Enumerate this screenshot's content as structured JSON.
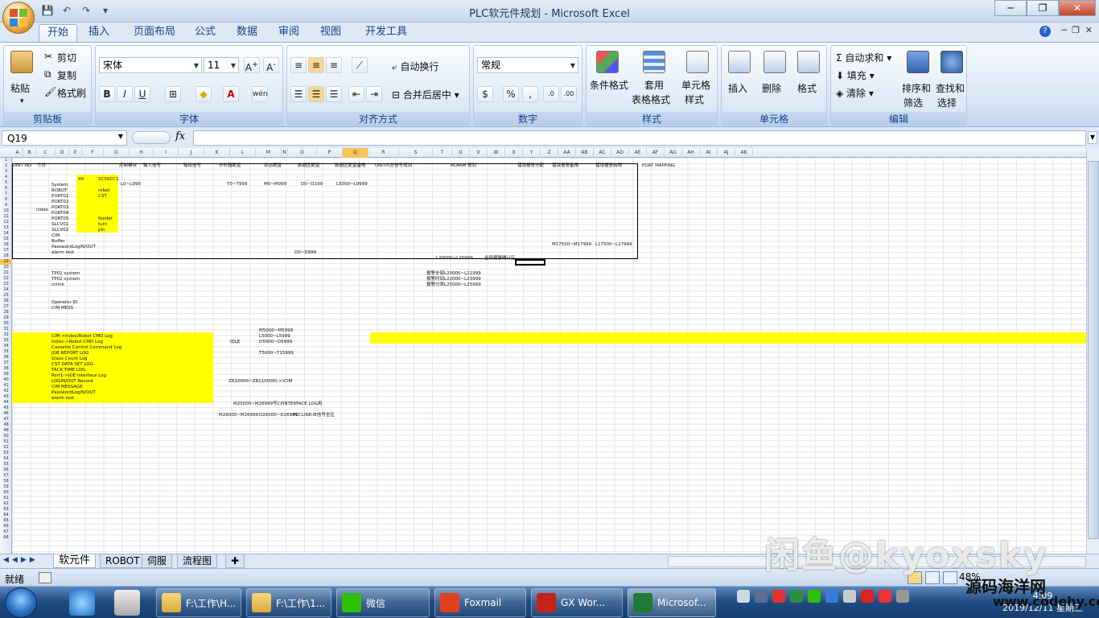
{
  "window": {
    "title": "PLC软元件规划 - Microsoft Excel"
  },
  "tabs": [
    "开始",
    "插入",
    "页面布局",
    "公式",
    "数据",
    "审阅",
    "视图",
    "开发工具"
  ],
  "ribbon": {
    "clipboard": {
      "label": "剪贴板",
      "paste": "粘贴",
      "cut": "剪切",
      "copy": "复制",
      "format_painter": "格式刷"
    },
    "font": {
      "label": "字体",
      "name": "宋体",
      "size": "11"
    },
    "alignment": {
      "label": "对齐方式",
      "wrap": "自动换行",
      "merge": "合并后居中"
    },
    "number": {
      "label": "数字",
      "format": "常规"
    },
    "styles": {
      "label": "样式",
      "cond": "条件格式",
      "table1": "套用",
      "table2": "表格格式",
      "cell1": "单元格",
      "cell2": "样式"
    },
    "cells": {
      "label": "单元格",
      "insert": "插入",
      "delete": "删除",
      "format": "格式"
    },
    "editing": {
      "label": "编辑",
      "autosum": "自动求和",
      "fill": "填充",
      "clear": "清除",
      "sort1": "排序和",
      "sort2": "筛选",
      "find1": "查找和",
      "find2": "选择"
    }
  },
  "formula_bar": {
    "name_box": "Q19",
    "fx": "fx",
    "value": ""
  },
  "sheet": {
    "columns": [
      "A",
      "B",
      "C",
      "D",
      "E",
      "F",
      "G",
      "H",
      "I",
      "J",
      "K",
      "L",
      "M",
      "N",
      "O",
      "P",
      "Q",
      "R",
      "S",
      "T",
      "U",
      "V",
      "W",
      "X",
      "Y",
      "Z",
      "AA",
      "AB",
      "AC",
      "AD",
      "AE",
      "AF",
      "AG",
      "AH",
      "AI",
      "AJ",
      "AK"
    ],
    "rows_visible": 68,
    "texts": [
      {
        "t": "UNIT NO"
      },
      {
        "t": "三日"
      },
      {
        "t": "控制模块"
      },
      {
        "t": "输入信号"
      },
      {
        "t": "输出信号"
      },
      {
        "t": "计时器配置"
      },
      {
        "t": "状态配置"
      },
      {
        "t": "数据区配置"
      },
      {
        "t": "数据区配置备用"
      },
      {
        "t": "UNIT内总信号规划"
      },
      {
        "t": "ALARM 规划"
      },
      {
        "t": "错误报警分配"
      },
      {
        "t": "错误报警备用"
      },
      {
        "t": "错误报警启用"
      },
      {
        "t": "PORT MAPPING"
      },
      {
        "t": "X0"
      },
      {
        "t": "SCSSCC1"
      },
      {
        "t": "L0~L999"
      },
      {
        "t": "T0~T999"
      },
      {
        "t": "M0~M999"
      },
      {
        "t": "D0~D199"
      },
      {
        "t": "L5000~L9999"
      },
      {
        "t": "System"
      },
      {
        "t": "ROBOT"
      },
      {
        "t": "PORT01"
      },
      {
        "t": "PORT02"
      },
      {
        "t": "PORT03"
      },
      {
        "t": "PORT04"
      },
      {
        "t": "PORT05"
      },
      {
        "t": "SLCV01"
      },
      {
        "t": "SLCV02"
      },
      {
        "t": "CIM"
      },
      {
        "t": "Buffer"
      },
      {
        "t": "PasswordLogIN/OUT"
      },
      {
        "t": "alarm test"
      },
      {
        "t": "index"
      },
      {
        "t": "robot"
      },
      {
        "t": "CST"
      },
      {
        "t": "feeder"
      },
      {
        "t": "turn"
      },
      {
        "t": "pin"
      },
      {
        "t": "TP01 system"
      },
      {
        "t": "TP02 system"
      },
      {
        "t": "cclink"
      },
      {
        "t": "Operator ID"
      },
      {
        "t": "CIM MESS"
      },
      {
        "t": "CIM->Index/Robot CMD Log"
      },
      {
        "t": "Index->Robot CMD Log"
      },
      {
        "t": "Cassette Control Command Log"
      },
      {
        "t": "JOB REPORT LOG"
      },
      {
        "t": "Glass Count Log"
      },
      {
        "t": "CST DATA SET LOG"
      },
      {
        "t": "TACK TIME LOG"
      },
      {
        "t": "Port1->JUE Interface Log"
      },
      {
        "t": "LOGIN/OUT Record"
      },
      {
        "t": "CIM MESSAGE"
      },
      {
        "t": "PasswordLogIN/OUT"
      },
      {
        "t": "alarm test"
      },
      {
        "t": "IDLE"
      },
      {
        "t": "M5000~M5999"
      },
      {
        "t": "L5000~L5999"
      },
      {
        "t": "D5000~D5999"
      },
      {
        "t": "T5000~T15999"
      },
      {
        "t": "ZR10000~ZR110000(->)CIM"
      },
      {
        "t": "M25000~M26999写CPINTERFACE LOG用"
      },
      {
        "t": "M26000~M26999"
      },
      {
        "t": "D26000~D26999"
      },
      {
        "t": "PCCLINK-IE信号全区"
      },
      {
        "t": "L20000~L25999"
      },
      {
        "t": "全部报警确认区"
      },
      {
        "t": "报警全部L20000~L21999"
      },
      {
        "t": "报警时间L22000~L23999"
      },
      {
        "t": "报警分类L25000~L25999"
      },
      {
        "t": "D0~D999"
      },
      {
        "t": "M17500~M17999"
      },
      {
        "t": "L17500~L17999"
      }
    ],
    "highlight_row": 33
  },
  "sheet_tabs": [
    "软元件",
    "ROBOT",
    "伺服",
    "流程图"
  ],
  "status": {
    "ready": "就绪",
    "zoom": "48%"
  },
  "taskbar": {
    "items": [
      "F:\\工作\\H...",
      "F:\\工作\\1...",
      "微信",
      "Foxmail",
      "GX Wor...",
      "Microsof..."
    ],
    "time": "4:09",
    "date": "2019/12/11 星期三"
  },
  "watermark": {
    "text1": "闲鱼@kyoxsky",
    "text2": "源码海洋网",
    "text3": "www.codehy.com"
  },
  "colors": {
    "accent": "#15428b",
    "highlight": "#ffff00",
    "ribbon_bg": "#dfe8f5"
  }
}
